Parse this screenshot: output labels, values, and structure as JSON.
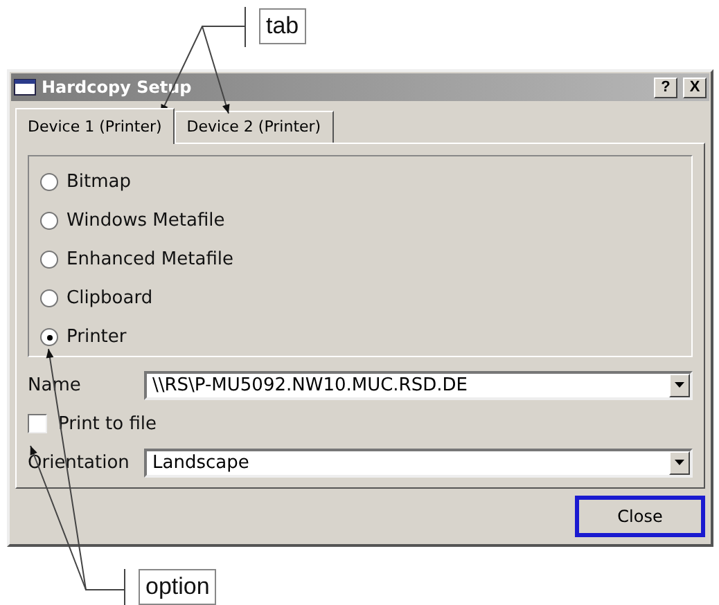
{
  "annotations": [
    {
      "text": "tab"
    },
    {
      "text": "option"
    }
  ],
  "window": {
    "title": "Hardcopy Setup",
    "title_buttons": [
      "?",
      "X"
    ]
  },
  "tabs": [
    {
      "label": "Device 1 (Printer)",
      "selected": true
    },
    {
      "label": "Device 2 (Printer)",
      "selected": false
    }
  ],
  "format_options": [
    {
      "label": "Bitmap",
      "selected": false
    },
    {
      "label": "Windows Metafile",
      "selected": false
    },
    {
      "label": "Enhanced Metafile",
      "selected": false
    },
    {
      "label": "Clipboard",
      "selected": false
    },
    {
      "label": "Printer",
      "selected": true
    }
  ],
  "name": {
    "label": "Name",
    "value": "\\\\RS\\P-MU5092.NW10.MUC.RSD.DE"
  },
  "print_to_file": {
    "label": "Print to file",
    "checked": false
  },
  "orientation": {
    "label": "Orientation",
    "value": "Landscape"
  },
  "buttons": [
    {
      "label": "Close",
      "focused": true
    }
  ]
}
